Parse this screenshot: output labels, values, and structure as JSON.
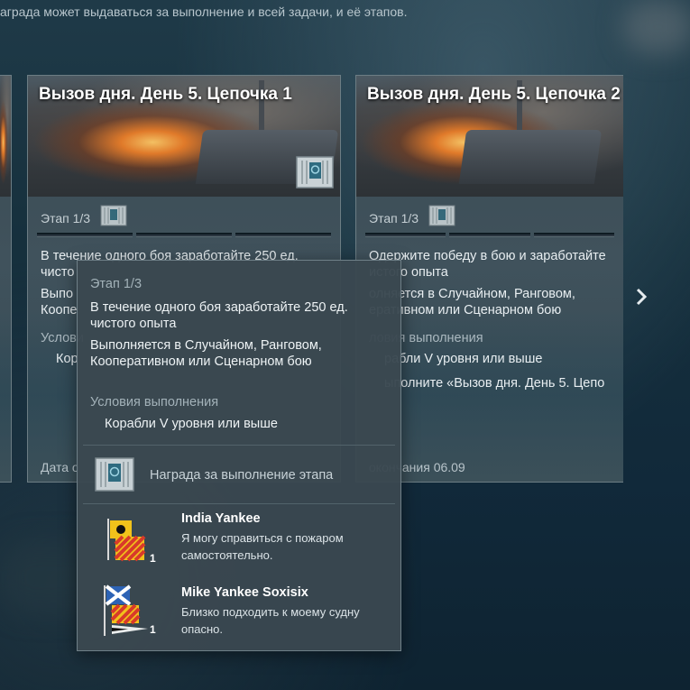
{
  "top_hint": "аграда может выдаваться за выполнение и всей задачи, и её этапов.",
  "cards": [
    {
      "title": "Вызов дня. День 5. Цепочка 1",
      "stage": "Этап 1/3",
      "task_line1": "В течение одного боя заработайте 250 ед.",
      "task_line2": "чисто",
      "mode_line1": "Выпо",
      "mode_line2": "Коопе",
      "conditions_heading": "Услови",
      "condition_item": "Кор",
      "footer": "Дата о"
    },
    {
      "title": "Вызов дня. День 5. Цепочка 2",
      "stage": "Этап 1/3",
      "task_line1": "Одержите победу в бою и заработайте",
      "task_line2": "истого опыта",
      "mode_line1": "олняется в Случайном, Ранговом,",
      "mode_line2": "еративном или Сценарном бою",
      "conditions_heading": "ловия выполнения",
      "condition_item1": "рабли V уровня или выше",
      "condition_item2": "ыполните «Вызов дня. День 5. Цепо",
      "footer": "окончания 06.09"
    }
  ],
  "tooltip": {
    "stage": "Этап 1/3",
    "task_line1": "В течение одного боя заработайте 250 ед.",
    "task_line2": "чистого опыта",
    "mode_line1": "Выполняется в Случайном, Ранговом,",
    "mode_line2": "Кооперативном или Сценарном бою",
    "conditions_heading": "Условия выполнения",
    "condition": "Корабли V уровня или выше",
    "reward_heading": "Награда за выполнение этапа",
    "rewards": [
      {
        "name": "India Yankee",
        "desc_line1": "Я могу справиться с пожаром",
        "desc_line2": "самостоятельно.",
        "count": "1"
      },
      {
        "name": "Mike Yankee Soxisix",
        "desc_line1": "Близко подходить к моему судну",
        "desc_line2": "опасно.",
        "count": "1"
      }
    ]
  },
  "icons": {
    "container": "container-icon",
    "next": "chevron-right-icon",
    "flag_india_yankee": "signal-flag-icon",
    "flag_mike_yankee_soxisix": "signal-flag-icon"
  }
}
